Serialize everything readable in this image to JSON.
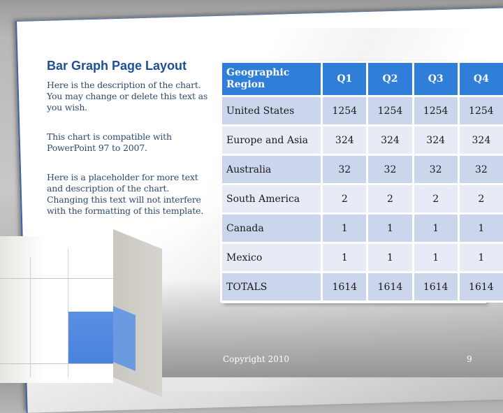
{
  "slide": {
    "title": "Bar Graph Page Layout",
    "paragraphs": [
      "Here is the description of the chart. You may change or delete this text as you wish.",
      "This chart is compatible with PowerPoint 97 to 2007.",
      "Here is a placeholder for more text and description of the chart. Changing this text will not interfere with the formatting of this template."
    ],
    "footer": {
      "copyright": "Copyright 2010",
      "page_number": "9"
    },
    "colors": {
      "title": "#1f4f95",
      "header_fill": "#2f7ed8",
      "row_dark": "#cbd6ec",
      "row_light": "#e6ebf5",
      "accent_cube": "#4a82dc"
    }
  },
  "table": {
    "headers": [
      "Geographic Region",
      "Q1",
      "Q2",
      "Q3",
      "Q4"
    ],
    "rows": [
      {
        "region": "United States",
        "values": [
          "1254",
          "1254",
          "1254",
          "1254"
        ]
      },
      {
        "region": "Europe and Asia",
        "values": [
          "324",
          "324",
          "324",
          "324"
        ]
      },
      {
        "region": "Australia",
        "values": [
          "32",
          "32",
          "32",
          "32"
        ]
      },
      {
        "region": "South America",
        "values": [
          "2",
          "2",
          "2",
          "2"
        ]
      },
      {
        "region": "Canada",
        "values": [
          "1",
          "1",
          "1",
          "1"
        ]
      },
      {
        "region": "Mexico",
        "values": [
          "1",
          "1",
          "1",
          "1"
        ]
      },
      {
        "region": "TOTALS",
        "values": [
          "1614",
          "1614",
          "1614",
          "1614"
        ]
      }
    ]
  }
}
